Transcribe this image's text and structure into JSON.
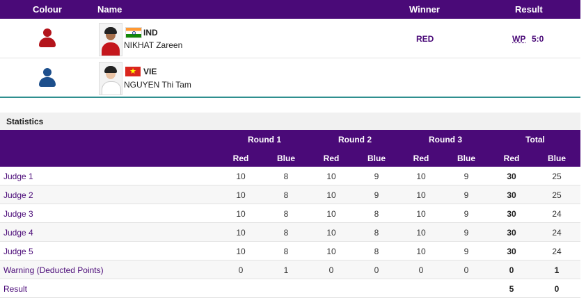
{
  "header": {
    "colour": "Colour",
    "name": "Name",
    "winner": "Winner",
    "result": "Result"
  },
  "red": {
    "noc": "IND",
    "name": "NIKHAT Zareen",
    "winner": "RED",
    "method": "WP",
    "score": "5:0",
    "colors": {
      "corner": "#b3141b"
    }
  },
  "blue": {
    "noc": "VIE",
    "name": "NGUYEN Thi Tam",
    "colors": {
      "corner": "#1d4f8c"
    }
  },
  "stats": {
    "title": "Statistics",
    "rounds": [
      "Round 1",
      "Round 2",
      "Round 3",
      "Total"
    ],
    "sub": [
      "Red",
      "Blue"
    ],
    "rows": [
      {
        "label": "Judge 1",
        "values": [
          "10",
          "8",
          "10",
          "9",
          "10",
          "9",
          "30",
          "25"
        ]
      },
      {
        "label": "Judge 2",
        "values": [
          "10",
          "8",
          "10",
          "9",
          "10",
          "9",
          "30",
          "25"
        ]
      },
      {
        "label": "Judge 3",
        "values": [
          "10",
          "8",
          "10",
          "8",
          "10",
          "9",
          "30",
          "24"
        ]
      },
      {
        "label": "Judge 4",
        "values": [
          "10",
          "8",
          "10",
          "8",
          "10",
          "9",
          "30",
          "24"
        ]
      },
      {
        "label": "Judge 5",
        "values": [
          "10",
          "8",
          "10",
          "8",
          "10",
          "9",
          "30",
          "24"
        ]
      },
      {
        "label": "Warning (Deducted Points)",
        "values": [
          "0",
          "1",
          "0",
          "0",
          "0",
          "0",
          "0",
          "1"
        ]
      },
      {
        "label": "Result",
        "values": [
          "",
          "",
          "",
          "",
          "",
          "",
          "5",
          "0"
        ]
      }
    ]
  },
  "theme": {
    "accent": "#4a0a78",
    "divider": "#2f8f8f"
  }
}
